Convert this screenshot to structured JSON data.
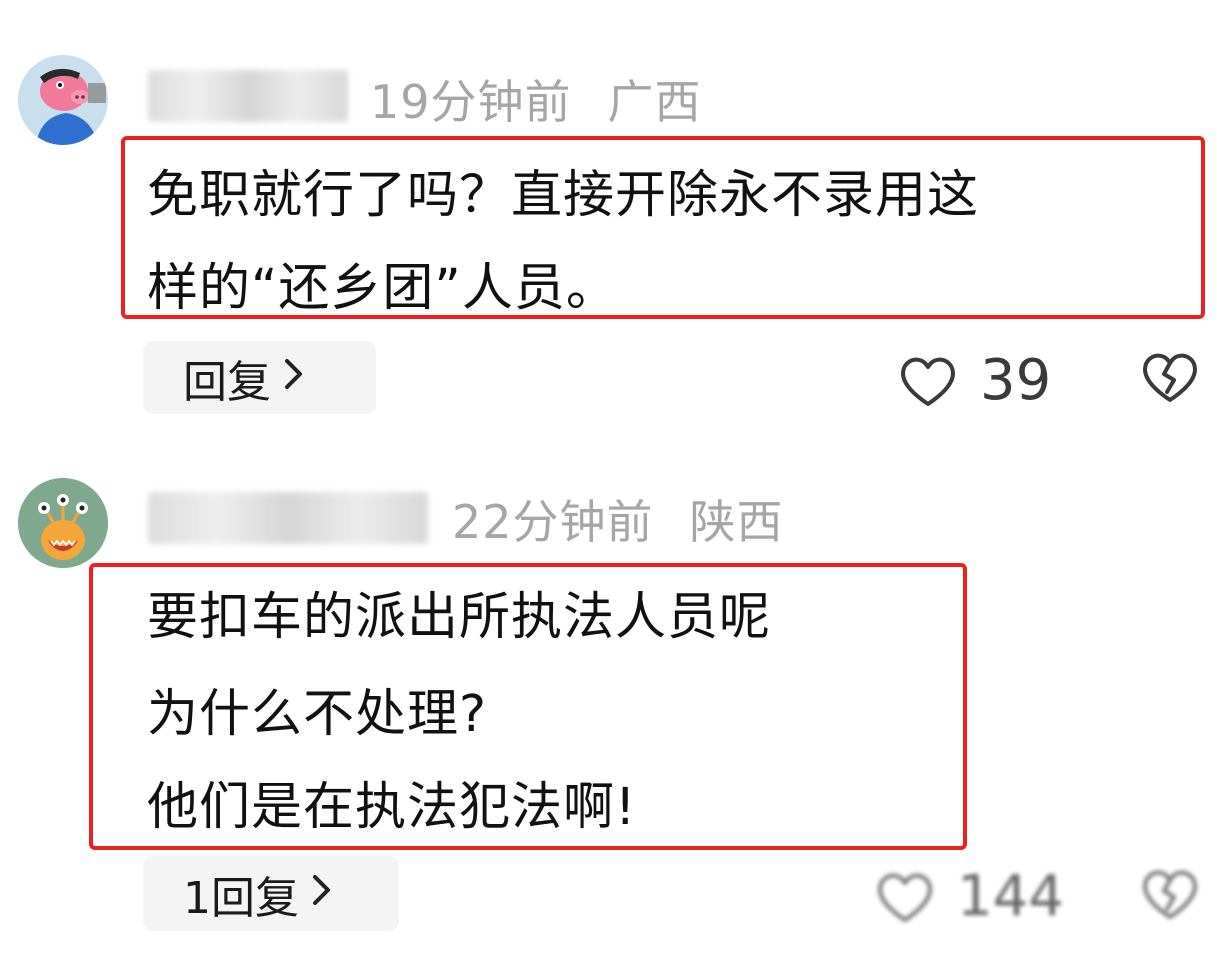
{
  "comments": [
    {
      "username": "",
      "time": "19分钟前",
      "location": "广西",
      "lines": [
        "免职就行了吗？直接开除永不录用这",
        "样的“还乡团”人员。"
      ],
      "reply_label": "回复",
      "likes": "39",
      "avatar_icon": "cartoon-pig-avatar"
    },
    {
      "username": "",
      "time": "22分钟前",
      "location": "陕西",
      "lines": [
        "要扣车的派出所执法人员呢",
        "为什么不处理?",
        "他们是在执法犯法啊!"
      ],
      "reply_label": "1回复",
      "likes": "144",
      "avatar_icon": "cartoon-monster-avatar"
    }
  ],
  "icons": {
    "reply_chevron": "chevron-right-icon",
    "like": "heart-icon",
    "dislike": "broken-heart-icon"
  },
  "colors": {
    "highlight_border": "#ec2020",
    "meta_text": "#a6a6a6",
    "reply_bg": "#f4f4f4"
  }
}
